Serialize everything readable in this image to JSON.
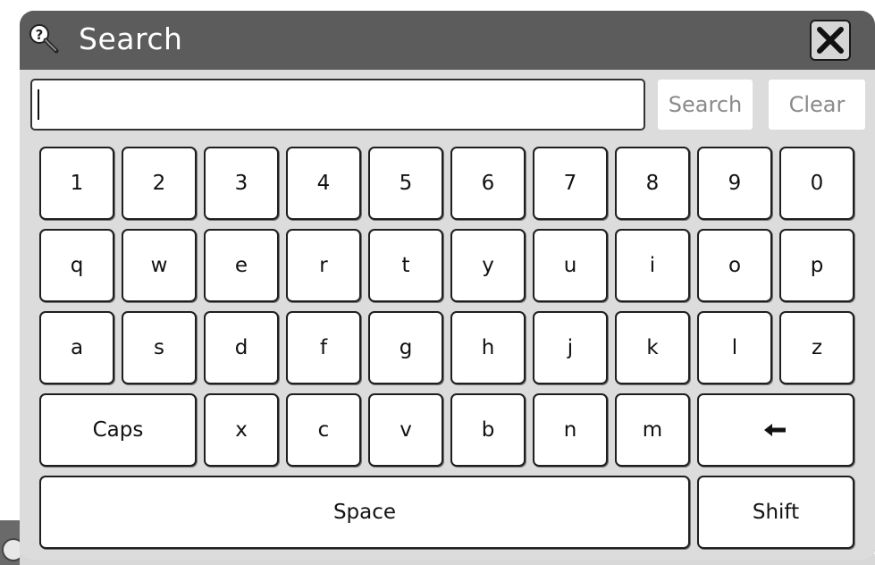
{
  "dialog": {
    "title": "Search",
    "icon": "search-help-icon",
    "close_icon": "close-icon"
  },
  "search": {
    "value": "",
    "search_button": "Search",
    "clear_button": "Clear"
  },
  "keyboard": {
    "rows": [
      [
        "1",
        "2",
        "3",
        "4",
        "5",
        "6",
        "7",
        "8",
        "9",
        "0"
      ],
      [
        "q",
        "w",
        "e",
        "r",
        "t",
        "y",
        "u",
        "i",
        "o",
        "p"
      ],
      [
        "a",
        "s",
        "d",
        "f",
        "g",
        "h",
        "j",
        "k",
        "l",
        "z"
      ],
      [
        "Caps",
        "x",
        "c",
        "v",
        "b",
        "n",
        "m",
        "backspace"
      ],
      [
        "Space",
        "Shift"
      ]
    ],
    "backspace_icon": "left-arrow-icon"
  },
  "colors": {
    "titlebar": "#5c5c5c",
    "panel": "#dcdcdc",
    "key": "#ffffff",
    "key_border": "#1e1e1e",
    "disabled_text": "#8a8a8a"
  }
}
